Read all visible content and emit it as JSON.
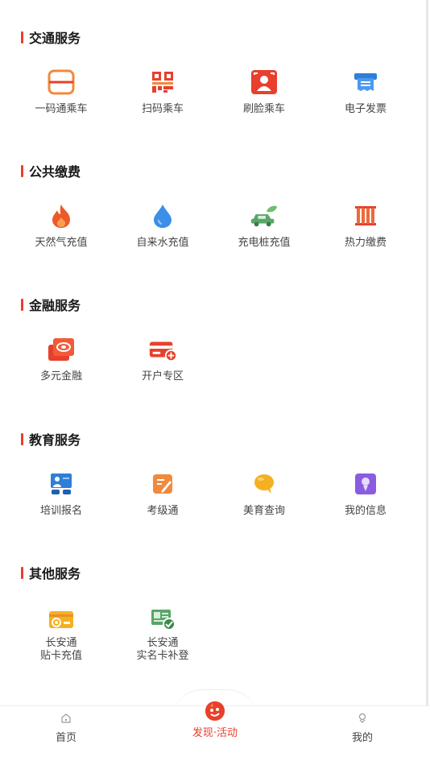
{
  "sections": [
    {
      "title": "交通服务",
      "items": [
        {
          "label": "一码通乘车",
          "icon": "qr-transit-icon"
        },
        {
          "label": "扫码乘车",
          "icon": "scan-qr-icon"
        },
        {
          "label": "刷脸乘车",
          "icon": "face-scan-icon"
        },
        {
          "label": "电子发票",
          "icon": "e-invoice-icon"
        }
      ]
    },
    {
      "title": "公共缴费",
      "items": [
        {
          "label": "天然气充值",
          "icon": "flame-icon"
        },
        {
          "label": "自来水充值",
          "icon": "water-drop-icon"
        },
        {
          "label": "充电桩充值",
          "icon": "electric-car-icon"
        },
        {
          "label": "热力缴费",
          "icon": "radiator-icon"
        }
      ]
    },
    {
      "title": "金融服务",
      "items": [
        {
          "label": "多元金融",
          "icon": "finance-card-icon"
        },
        {
          "label": "开户专区",
          "icon": "add-card-icon"
        }
      ]
    },
    {
      "title": "教育服务",
      "items": [
        {
          "label": "培训报名",
          "icon": "training-board-icon"
        },
        {
          "label": "考级通",
          "icon": "exam-pen-icon"
        },
        {
          "label": "美育查询",
          "icon": "chat-bubble-icon"
        },
        {
          "label": "我的信息",
          "icon": "profile-card-icon"
        }
      ]
    },
    {
      "title": "其他服务",
      "items": [
        {
          "label_line1": "长安通",
          "label_line2": "贴卡充值",
          "icon": "card-topup-icon"
        },
        {
          "label_line1": "长安通",
          "label_line2": "实名卡补登",
          "icon": "id-card-check-icon"
        }
      ]
    }
  ],
  "bottom_nav": {
    "home": "首页",
    "discover": "发现·活动",
    "mine": "我的"
  },
  "colors": {
    "accent": "#e8402c",
    "orange": "#f08a3e",
    "blue": "#3d8ee8",
    "green": "#5aa56a",
    "purple": "#8a5ce0",
    "yellow": "#f5b020"
  }
}
